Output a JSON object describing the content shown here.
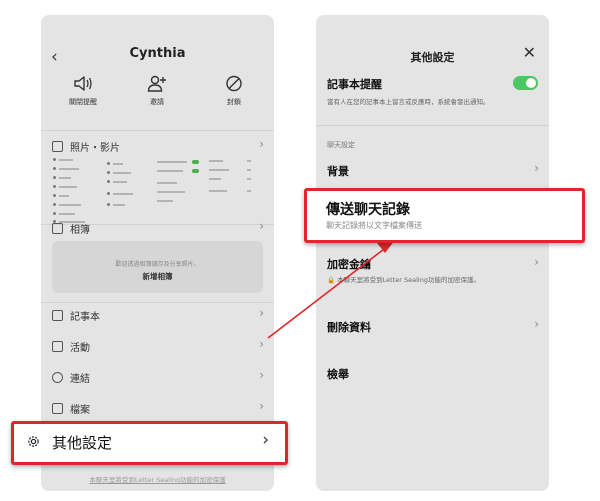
{
  "left_screen": {
    "title": "Cynthia",
    "actions": [
      {
        "icon": "speaker-icon",
        "label": "關閉提醒"
      },
      {
        "icon": "add-person-icon",
        "label": "邀請"
      },
      {
        "icon": "block-icon",
        "label": "封鎖"
      }
    ],
    "menu": {
      "photos": "照片・影片",
      "album": "相簿",
      "notes": "記事本",
      "events": "活動",
      "links": "連結",
      "files": "檔案",
      "other_settings": "其他設定"
    },
    "album_box": {
      "hint": "歡迎透過相簿儲存及分享照片。",
      "new_album": "新增相簿"
    },
    "footer_note": "本聊天室將受到Letter Sealing功能的加密保護"
  },
  "right_screen": {
    "title": "其他設定",
    "note_reminder": {
      "title": "記事本提醒",
      "description": "當有人在您的記事本上留言或反應時，系統會發出通知。",
      "enabled": true
    },
    "chat_settings_header": "聊天設定",
    "background": "背景",
    "send_history": {
      "title": "傳送聊天記錄",
      "subtitle": "聊天記錄將以文字檔案傳送"
    },
    "encryption_key": {
      "title": "加密金鑰",
      "description": "本聊天室將受到Letter Sealing功能的加密保護。"
    },
    "delete_data": "刪除資料",
    "report": "檢舉"
  },
  "colors": {
    "highlight_red": "#e0262a",
    "toggle_green": "#4cc764",
    "panel_bg": "#e4e4e4"
  }
}
